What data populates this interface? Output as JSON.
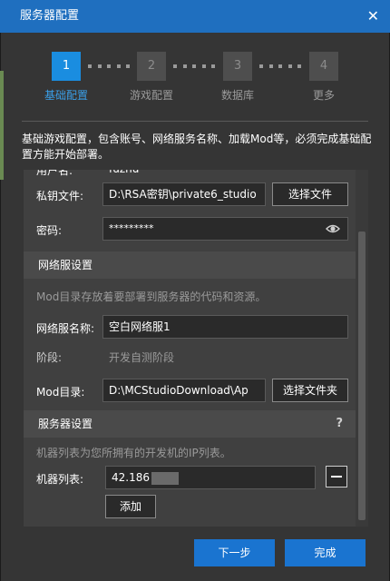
{
  "window": {
    "title": "服务器配置",
    "close_glyph": "✕"
  },
  "stepper": {
    "steps": [
      {
        "num": "1",
        "label": "基础配置",
        "active": true
      },
      {
        "num": "2",
        "label": "游戏配置",
        "active": false
      },
      {
        "num": "3",
        "label": "数据库",
        "active": false
      },
      {
        "num": "4",
        "label": "更多",
        "active": false
      }
    ]
  },
  "description": "基础游戏配置，包含账号、网络服务名称、加载Mod等，必须完成基础配置方能开始部署。",
  "account": {
    "cut_label": "用户名:",
    "cut_value": "fuzhu",
    "key_label": "私钥文件:",
    "key_value": "D:\\RSA密钥\\private6_studio",
    "key_button": "选择文件",
    "password_label": "密码:",
    "password_value": "*********"
  },
  "network": {
    "section_title": "网络服设置",
    "note": "Mod目录存放着要部署到服务器的代码和资源。",
    "name_label": "网络服名称:",
    "name_value": "空白网络服1",
    "stage_label": "阶段:",
    "stage_value": "开发自测阶段",
    "mod_label": "Mod目录:",
    "mod_value": "D:\\MCStudioDownload\\Ap",
    "mod_button": "选择文件夹"
  },
  "server": {
    "section_title": "服务器设置",
    "help": "?",
    "note": "机器列表为您所拥有的开发机的IP列表。",
    "list_label": "机器列表:",
    "list_value": "42.186",
    "add_button": "添加"
  },
  "footer": {
    "next_button": "下一步",
    "finish_button": "完成"
  },
  "colors": {
    "accent": "#1a8de0",
    "titlebar": "#1f6fbf",
    "primary_button": "#1a74d0"
  }
}
